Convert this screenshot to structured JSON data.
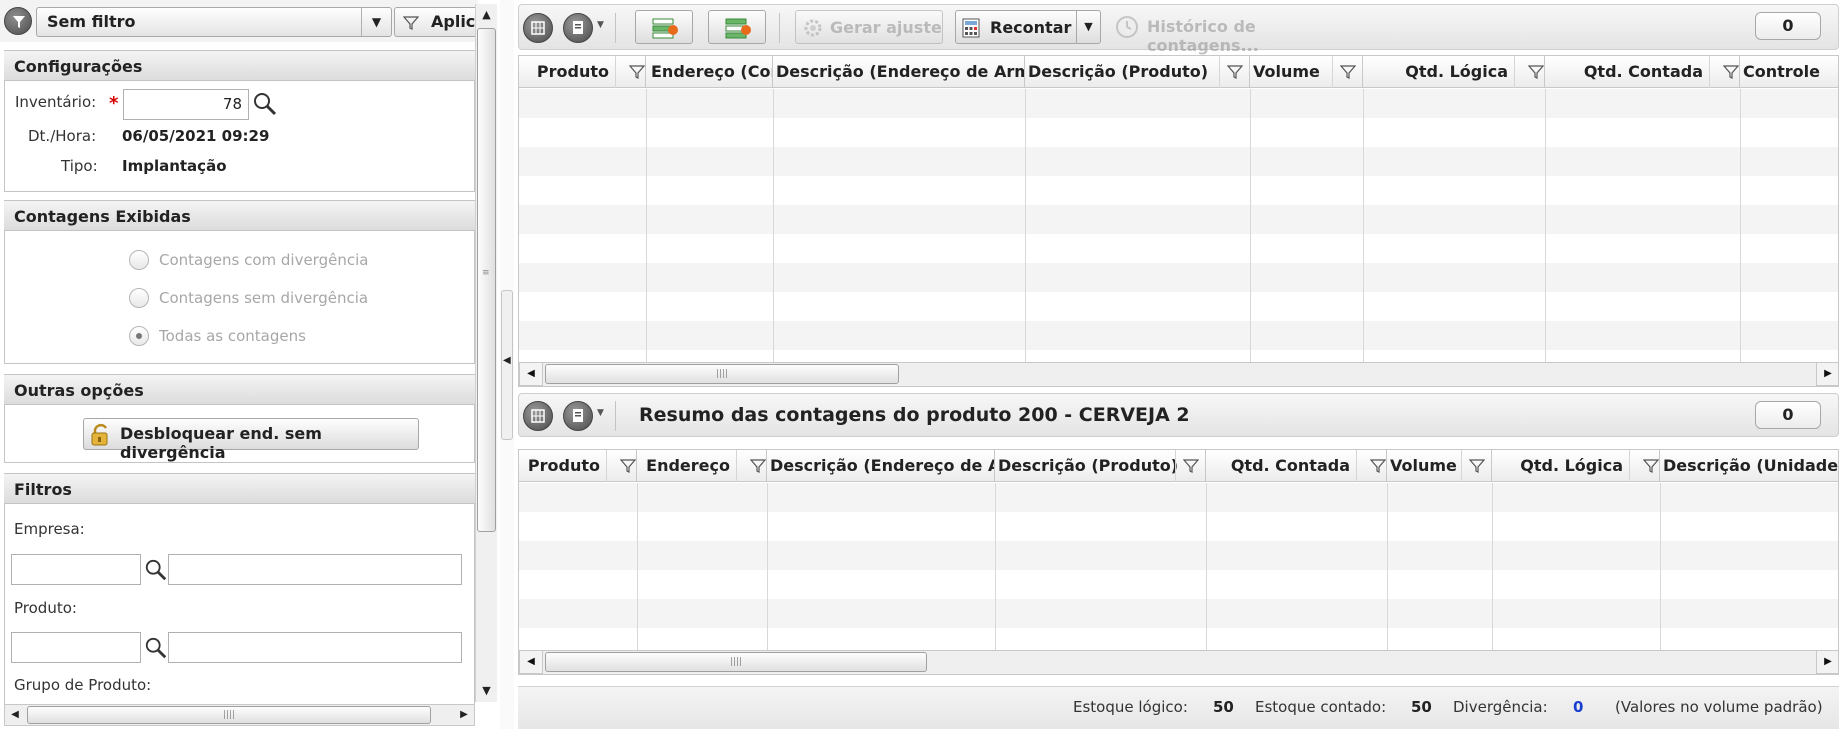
{
  "filter_bar": {
    "filter_value": "Sem filtro",
    "apply_label": "Aplic"
  },
  "config": {
    "title": "Configurações",
    "inventory_label": "Inventário:",
    "inventory_value": "78",
    "datetime_label": "Dt./Hora:",
    "datetime_value": "06/05/2021 09:29",
    "type_label": "Tipo:",
    "type_value": "Implantação"
  },
  "counts": {
    "title": "Contagens Exibidas",
    "options": [
      "Contagens com divergência",
      "Contagens sem divergência",
      "Todas as contagens"
    ],
    "selected": "Todas as contagens"
  },
  "other": {
    "title": "Outras opções",
    "unlock_label": "Desbloquear end. sem divergência"
  },
  "filters": {
    "title": "Filtros",
    "empresa_label": "Empresa:",
    "produto_label": "Produto:",
    "grupo_label": "Grupo de Produto:"
  },
  "top_grid": {
    "toolbar": {
      "adjust_label": "Gerar ajuste",
      "recount_label": "Recontar",
      "history_label": "Histórico de contagens..."
    },
    "count": "0",
    "columns": [
      "Produto",
      "Endereço (Con",
      "Descrição (Endereço de Arma",
      "Descrição (Produto)",
      "Volume",
      "Qtd. Lógica",
      "Qtd. Contada",
      "Controle"
    ]
  },
  "bottom_grid": {
    "title": "Resumo das contagens do produto 200 - CERVEJA 2",
    "count": "0",
    "columns": [
      "Produto",
      "Endereço",
      "Descrição (Endereço de Ar",
      "Descrição (Produto)",
      "Qtd. Contada",
      "Volume",
      "Qtd. Lógica",
      "Descrição (Unidade)"
    ]
  },
  "footer": {
    "logical_label": "Estoque lógico:",
    "logical_value": "50",
    "counted_label": "Estoque contado:",
    "counted_value": "50",
    "divergence_label": "Divergência:",
    "divergence_value": "0",
    "note": "(Valores no volume padrão)"
  },
  "colors": {
    "required": "#d40000",
    "divergence_value": "#1a3fd1"
  }
}
